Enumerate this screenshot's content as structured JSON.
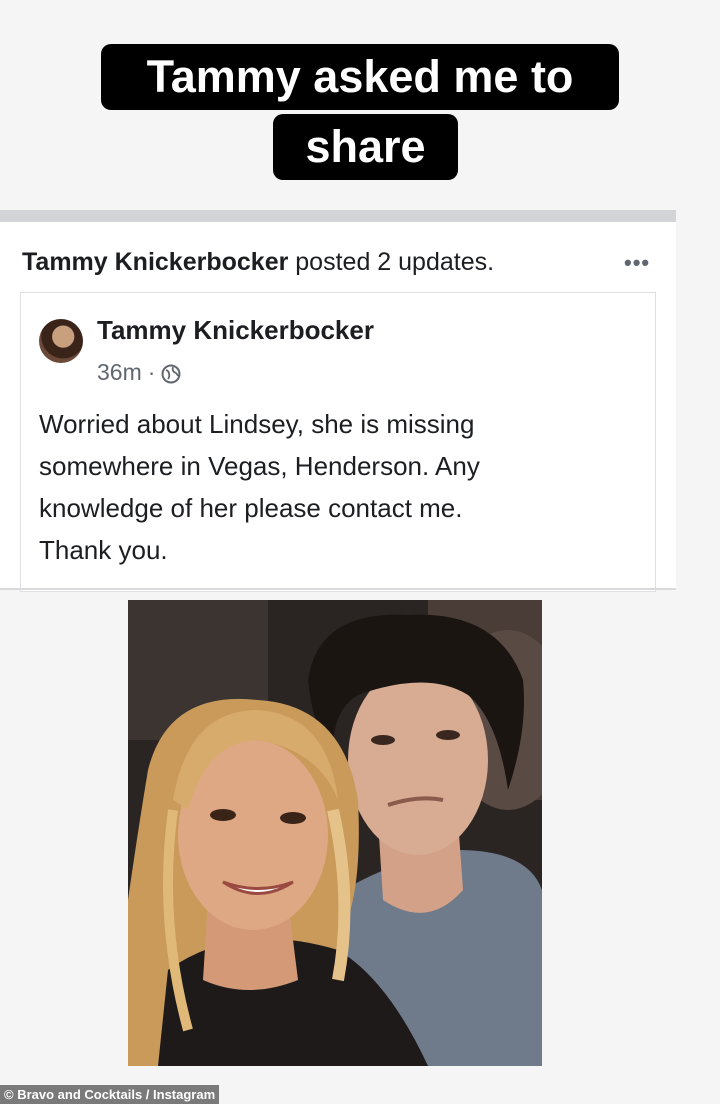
{
  "caption": {
    "line1": "Tammy asked me to",
    "line2": "share"
  },
  "post_header": {
    "author": "Tammy Knickerbocker",
    "action": "posted 2 updates.",
    "more_icon": "more-horizontal-icon",
    "more_label": "•••"
  },
  "shared_post": {
    "author": "Tammy Knickerbocker",
    "time": "36m",
    "separator": "·",
    "audience_icon": "globe-icon",
    "text": "Worried about Lindsey, she is missing\nsomewhere in Vegas, Henderson.  Any\nknowledge of her please contact me.\nThank you."
  },
  "credit": "© Bravo and Cocktails / Instagram",
  "colors": {
    "caption_bg": "#000000",
    "caption_text": "#ffffff",
    "card_border": "#d2d4d8",
    "meta_text": "#606770"
  }
}
